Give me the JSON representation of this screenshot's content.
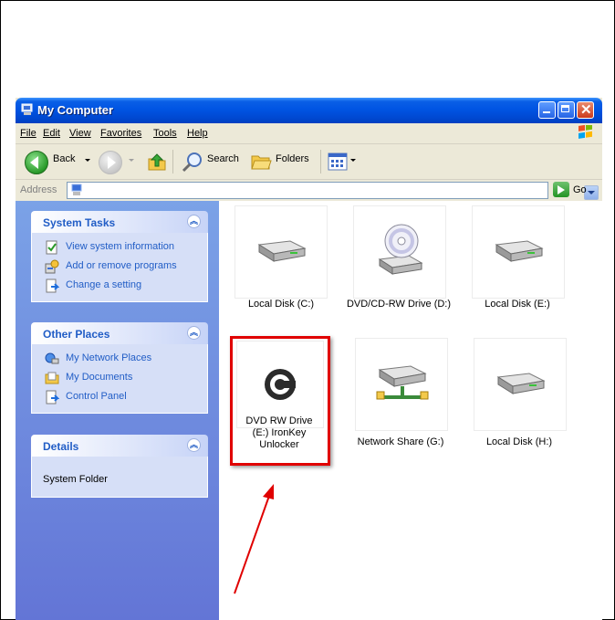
{
  "window": {
    "title": "My Computer"
  },
  "menu": {
    "items": [
      "File",
      "Edit",
      "View",
      "Favorites",
      "Tools",
      "Help"
    ]
  },
  "toolbar": {
    "back_label": "Back",
    "search_label": "Search",
    "folders_label": "Folders"
  },
  "address": {
    "label": "Address",
    "go_label": "Go"
  },
  "sidebar": {
    "system_tasks": {
      "title": "System Tasks",
      "items": [
        "View system information",
        "Add or remove programs",
        "Change a setting"
      ]
    },
    "other_places": {
      "title": "Other Places",
      "items": [
        "My Network Places",
        "My Documents",
        "Control Panel"
      ]
    },
    "details": {
      "title": "Details",
      "text": "System Folder"
    }
  },
  "drives": [
    {
      "label": "Local Disk (C:)",
      "icon": "hard-disk-icon"
    },
    {
      "label": "DVD/CD-RW Drive (D:)",
      "icon": "dvd-drive-icon"
    },
    {
      "label": "Local Disk (E:)",
      "icon": "hard-disk-icon"
    },
    {
      "label_lines": [
        "DVD RW Drive",
        "(E:) IronKey",
        "Unlocker"
      ],
      "icon": "ironkey-icon",
      "highlighted": true
    },
    {
      "label": "Network Share (G:)",
      "icon": "network-drive-icon"
    },
    {
      "label": "Local Disk (H:)",
      "icon": "hard-disk-icon"
    }
  ],
  "colors": {
    "highlight": "#e00000",
    "arrow": "#e00000",
    "titlebar": "#0054e3",
    "sidebar_link": "#215dc6"
  }
}
